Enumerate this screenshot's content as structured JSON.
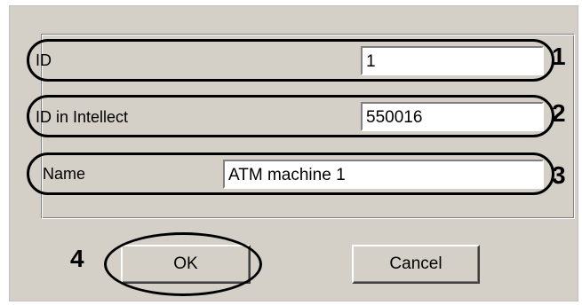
{
  "fields": [
    {
      "label": "ID",
      "value": "1",
      "callout": "1"
    },
    {
      "label": "ID in Intellect",
      "value": "550016",
      "callout": "2"
    },
    {
      "label": "Name",
      "value": "ATM machine 1",
      "callout": "3"
    }
  ],
  "buttons": {
    "ok_label": "OK",
    "cancel_label": "Cancel",
    "ok_callout": "4"
  }
}
